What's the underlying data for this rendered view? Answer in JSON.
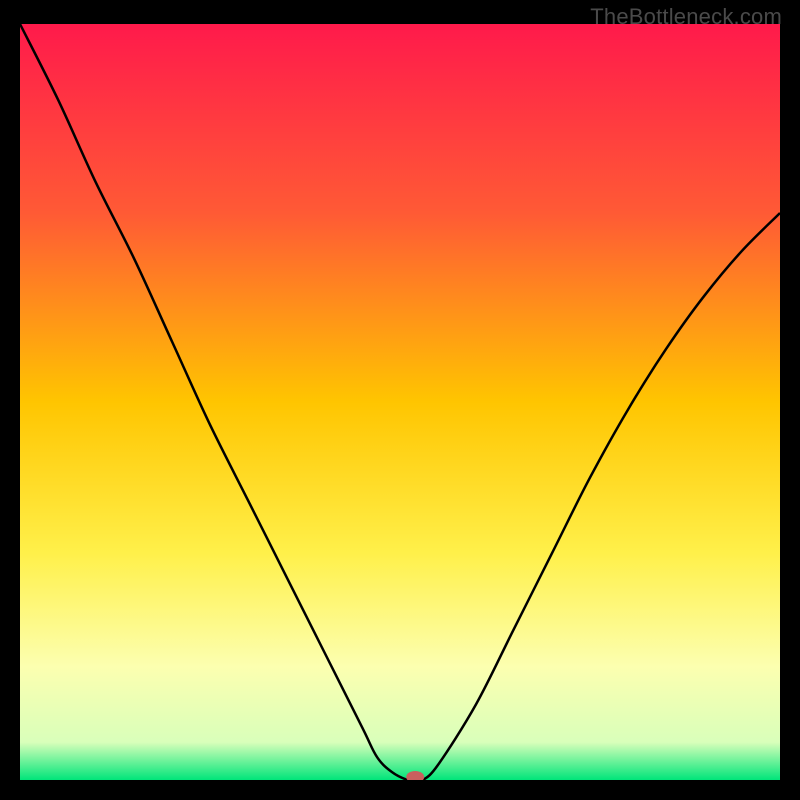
{
  "watermark": "TheBottleneck.com",
  "chart_data": {
    "type": "line",
    "title": "",
    "xlabel": "",
    "ylabel": "",
    "xlim": [
      0,
      100
    ],
    "ylim": [
      0,
      100
    ],
    "background": {
      "type": "vertical-gradient",
      "stops": [
        {
          "offset": 0,
          "color": "#ff1a4b"
        },
        {
          "offset": 25,
          "color": "#ff5a35"
        },
        {
          "offset": 50,
          "color": "#ffc500"
        },
        {
          "offset": 70,
          "color": "#fff04a"
        },
        {
          "offset": 85,
          "color": "#fcffb0"
        },
        {
          "offset": 95,
          "color": "#d9ffba"
        },
        {
          "offset": 100,
          "color": "#00e57a"
        }
      ]
    },
    "series": [
      {
        "name": "bottleneck-curve",
        "color": "#000000",
        "x": [
          0,
          5,
          10,
          15,
          20,
          25,
          30,
          35,
          40,
          45,
          47,
          49,
          51,
          52,
          53,
          55,
          60,
          65,
          70,
          75,
          80,
          85,
          90,
          95,
          100
        ],
        "y": [
          100,
          90,
          79,
          69,
          58,
          47,
          37,
          27,
          17,
          7,
          3,
          1,
          0,
          0,
          0,
          2,
          10,
          20,
          30,
          40,
          49,
          57,
          64,
          70,
          75
        ]
      }
    ],
    "marker": {
      "name": "optimal-point",
      "x": 52,
      "y": 0,
      "color": "#c9605e",
      "rx": 9,
      "ry": 6
    }
  }
}
